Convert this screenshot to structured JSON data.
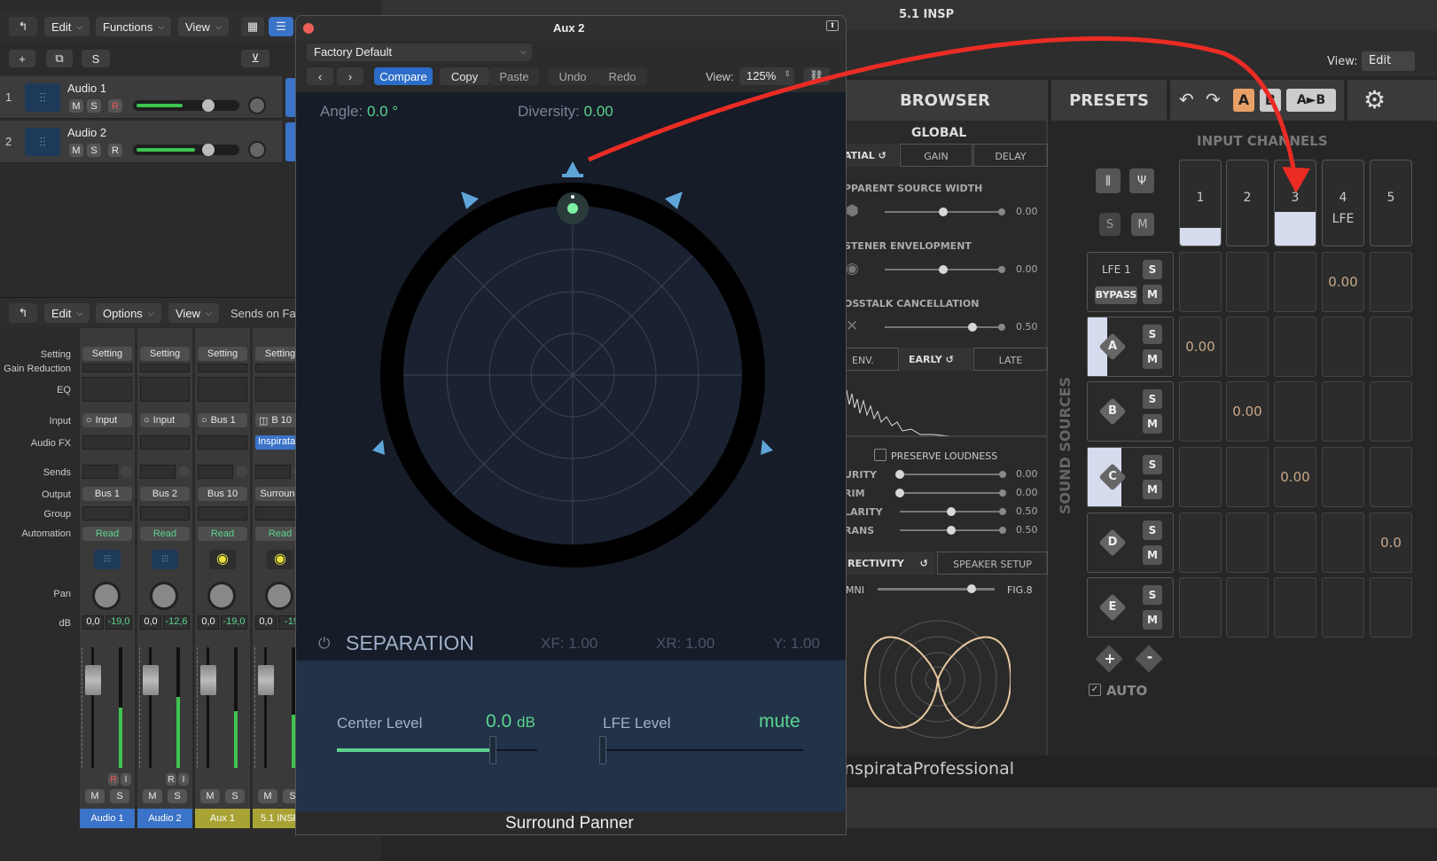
{
  "daw": {
    "menus": [
      "Edit",
      "Functions",
      "View"
    ],
    "mixer_menus": [
      "Edit",
      "Options",
      "View"
    ],
    "sends_label": "Sends on Fa",
    "s_btn": "S",
    "tracks": [
      {
        "num": "1",
        "name": "Audio 1",
        "m": "M",
        "s": "S",
        "r": "R"
      },
      {
        "num": "2",
        "name": "Audio 2",
        "m": "M",
        "s": "S",
        "r": "R"
      }
    ],
    "row_labels": [
      "Setting",
      "Gain Reduction",
      "EQ",
      "Input",
      "Audio FX",
      "Sends",
      "Output",
      "Group",
      "Automation",
      "Pan",
      "dB"
    ],
    "strips": [
      {
        "setting": "Setting",
        "input": "Input",
        "output": "Bus 1",
        "auto": "Read",
        "db1": "0,0",
        "db2": "-19,0",
        "name": "Audio 1",
        "m": "M",
        "s": "S",
        "color": "#3a73c8"
      },
      {
        "setting": "Setting",
        "input": "Input",
        "output": "Bus 2",
        "auto": "Read",
        "db1": "0,0",
        "db2": "-12,6",
        "name": "Audio 2",
        "m": "M",
        "s": "S",
        "color": "#3a73c8"
      },
      {
        "setting": "Setting",
        "input": "Bus 1",
        "output": "Bus 10",
        "auto": "Read",
        "db1": "0,0",
        "db2": "-19,0",
        "name": "Aux 1",
        "m": "M",
        "s": "S",
        "color": "#a8a334"
      },
      {
        "setting": "Setting",
        "input": "B 10",
        "output": "Surround",
        "auto": "Read",
        "db1": "0,0",
        "db2": "-19",
        "name": "5.1 INSP",
        "m": "M",
        "s": "S",
        "color": "#a8a334",
        "fx": "Inspirata"
      }
    ],
    "ri": [
      "R",
      "I"
    ]
  },
  "panner": {
    "title": "Aux 2",
    "preset": "Factory Default",
    "compare": "Compare",
    "copy": "Copy",
    "paste": "Paste",
    "undo": "Undo",
    "redo": "Redo",
    "view_label": "View:",
    "view_value": "125%",
    "angle_label": "Angle:",
    "angle_value": "0.0 °",
    "diversity_label": "Diversity:",
    "diversity_value": "0.00",
    "separation": "SEPARATION",
    "xf_label": "XF:",
    "xf_value": "1.00",
    "xr_label": "XR:",
    "xr_value": "1.00",
    "y_label": "Y:",
    "y_value": "1.00",
    "center_label": "Center Level",
    "center_value": "0.0",
    "center_unit": "dB",
    "lfe_label": "LFE Level",
    "lfe_value": "mute",
    "footer": "Surround Panner"
  },
  "insp": {
    "title": "5.1 INSP",
    "view_label": "View:",
    "view_value": "Edit",
    "browser": "BROWSER",
    "presets": "PRESETS",
    "ab": [
      "A",
      "B",
      "A►B"
    ],
    "global": "GLOBAL",
    "tabs1": [
      "ATIAL",
      "GAIN",
      "DELAY"
    ],
    "params1": [
      {
        "label": "PPARENT SOURCE WIDTH",
        "value": "0.00",
        "pos": 0.5
      },
      {
        "label": "STENER ENVELOPMENT",
        "value": "0.00",
        "pos": 0.5
      },
      {
        "label": "OSSTALK CANCELLATION",
        "value": "0.50",
        "pos": 0.75
      }
    ],
    "tabs2": [
      "ENV.",
      "EARLY",
      "LATE"
    ],
    "preserve": "PRESERVE LOUDNESS",
    "params2": [
      {
        "label": "URITY",
        "value": "0.00",
        "pos": 0.0
      },
      {
        "label": "RIM",
        "value": "0.00",
        "pos": 0.0
      },
      {
        "label": "LARITY",
        "value": "0.50",
        "pos": 0.5
      },
      {
        "label": "RANS",
        "value": "0.50",
        "pos": 0.5
      }
    ],
    "tabs3": [
      "IRECTIVITY",
      "SPEAKER SETUP"
    ],
    "omni": "MNI",
    "fig8": "FIG.8",
    "directivity": 0.8,
    "brand": "nspirataProfessional",
    "input_channels": "INPUT CHANNELS",
    "channels": [
      "1",
      "2",
      "3",
      "4",
      "5"
    ],
    "lfe_ch": "LFE",
    "sound_sources": "SOUND SOURCES",
    "lfe1": "LFE 1",
    "bypass": "BYPASS",
    "sources": [
      "A",
      "B",
      "C",
      "D",
      "E"
    ],
    "s": "S",
    "m": "M",
    "lfe_val": "0.00",
    "cell_vals": [
      "0.00",
      "0.00",
      "0.00",
      "0.0"
    ],
    "auto": "AUTO",
    "plus": "+",
    "minus": "-"
  }
}
